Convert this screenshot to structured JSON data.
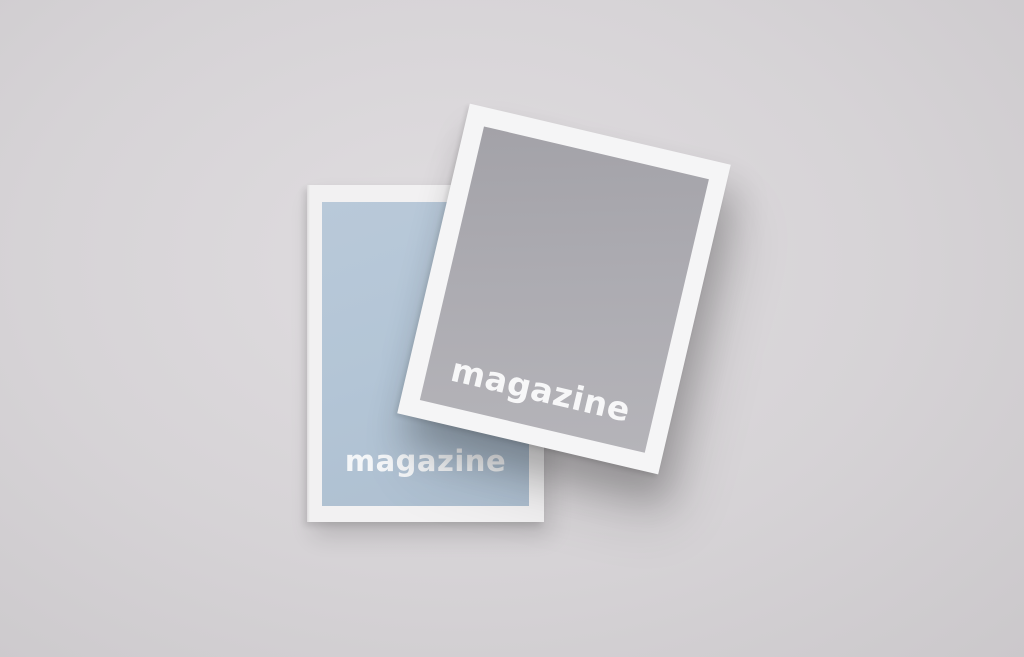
{
  "scene": {
    "background_color": "#d6d3d6",
    "magazines": [
      {
        "name": "back magazine",
        "cover_color": "#b5c6d7",
        "title": "magazine"
      },
      {
        "name": "front magazine",
        "cover_color": "#a9a8ae",
        "title": "magazine"
      }
    ]
  }
}
